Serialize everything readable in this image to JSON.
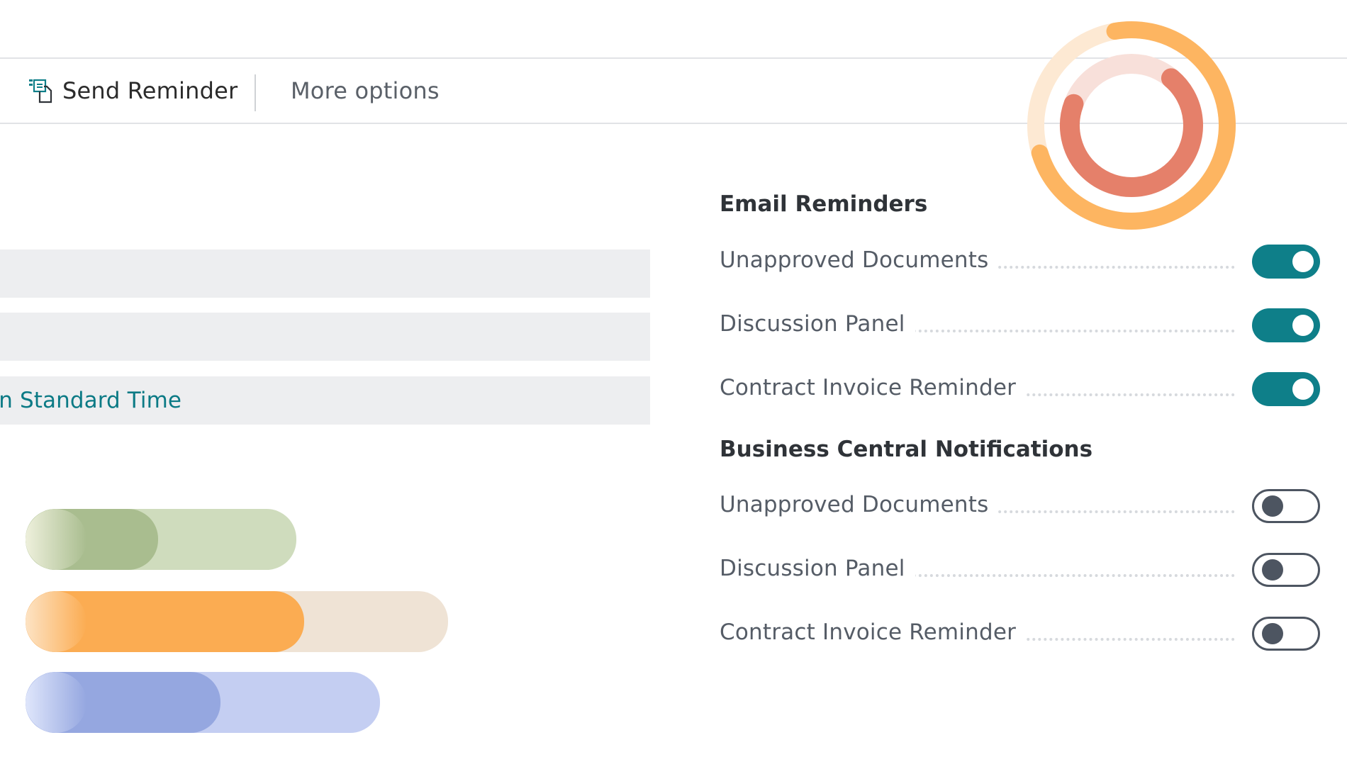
{
  "actionbar": {
    "send_reminder_label": "Send Reminder",
    "send_reminder_icon": "send-reminder-icon",
    "more_options_label": "More options"
  },
  "fields": [
    {
      "value": ""
    },
    {
      "value": ""
    },
    {
      "value": "rn Standard Time"
    }
  ],
  "email_reminders": {
    "title": "Email Reminders",
    "items": [
      {
        "label": "Unapproved Documents",
        "enabled": true
      },
      {
        "label": "Discussion Panel",
        "enabled": true
      },
      {
        "label": "Contract Invoice Reminder",
        "enabled": true
      }
    ]
  },
  "bc_notifications": {
    "title": "Business Central Notifications",
    "items": [
      {
        "label": "Unapproved Documents",
        "enabled": false
      },
      {
        "label": "Discussion Panel",
        "enabled": false
      },
      {
        "label": "Contract Invoice Reminder",
        "enabled": false
      }
    ]
  },
  "decorations": {
    "bars": [
      {
        "fill_fraction": 0.49,
        "track": "#cfdcbd",
        "fill": "#a9bd8f",
        "knob": "#eef0dc"
      },
      {
        "fill_fraction": 0.66,
        "track": "#efe3d5",
        "fill": "#fbac52",
        "knob": "#fde3c4"
      },
      {
        "fill_fraction": 0.55,
        "track": "#c4cef2",
        "fill": "#95a7e0",
        "knob": "#dfe6fb"
      }
    ],
    "donut": {
      "outer_color": "#fdb561",
      "outer_track": "#fde9d3",
      "inner_color": "#e5806a",
      "inner_track": "#f8e0da"
    }
  },
  "colors": {
    "accent": "#0e7f89",
    "link": "#0b7a85",
    "field_bg": "#edeef0"
  }
}
